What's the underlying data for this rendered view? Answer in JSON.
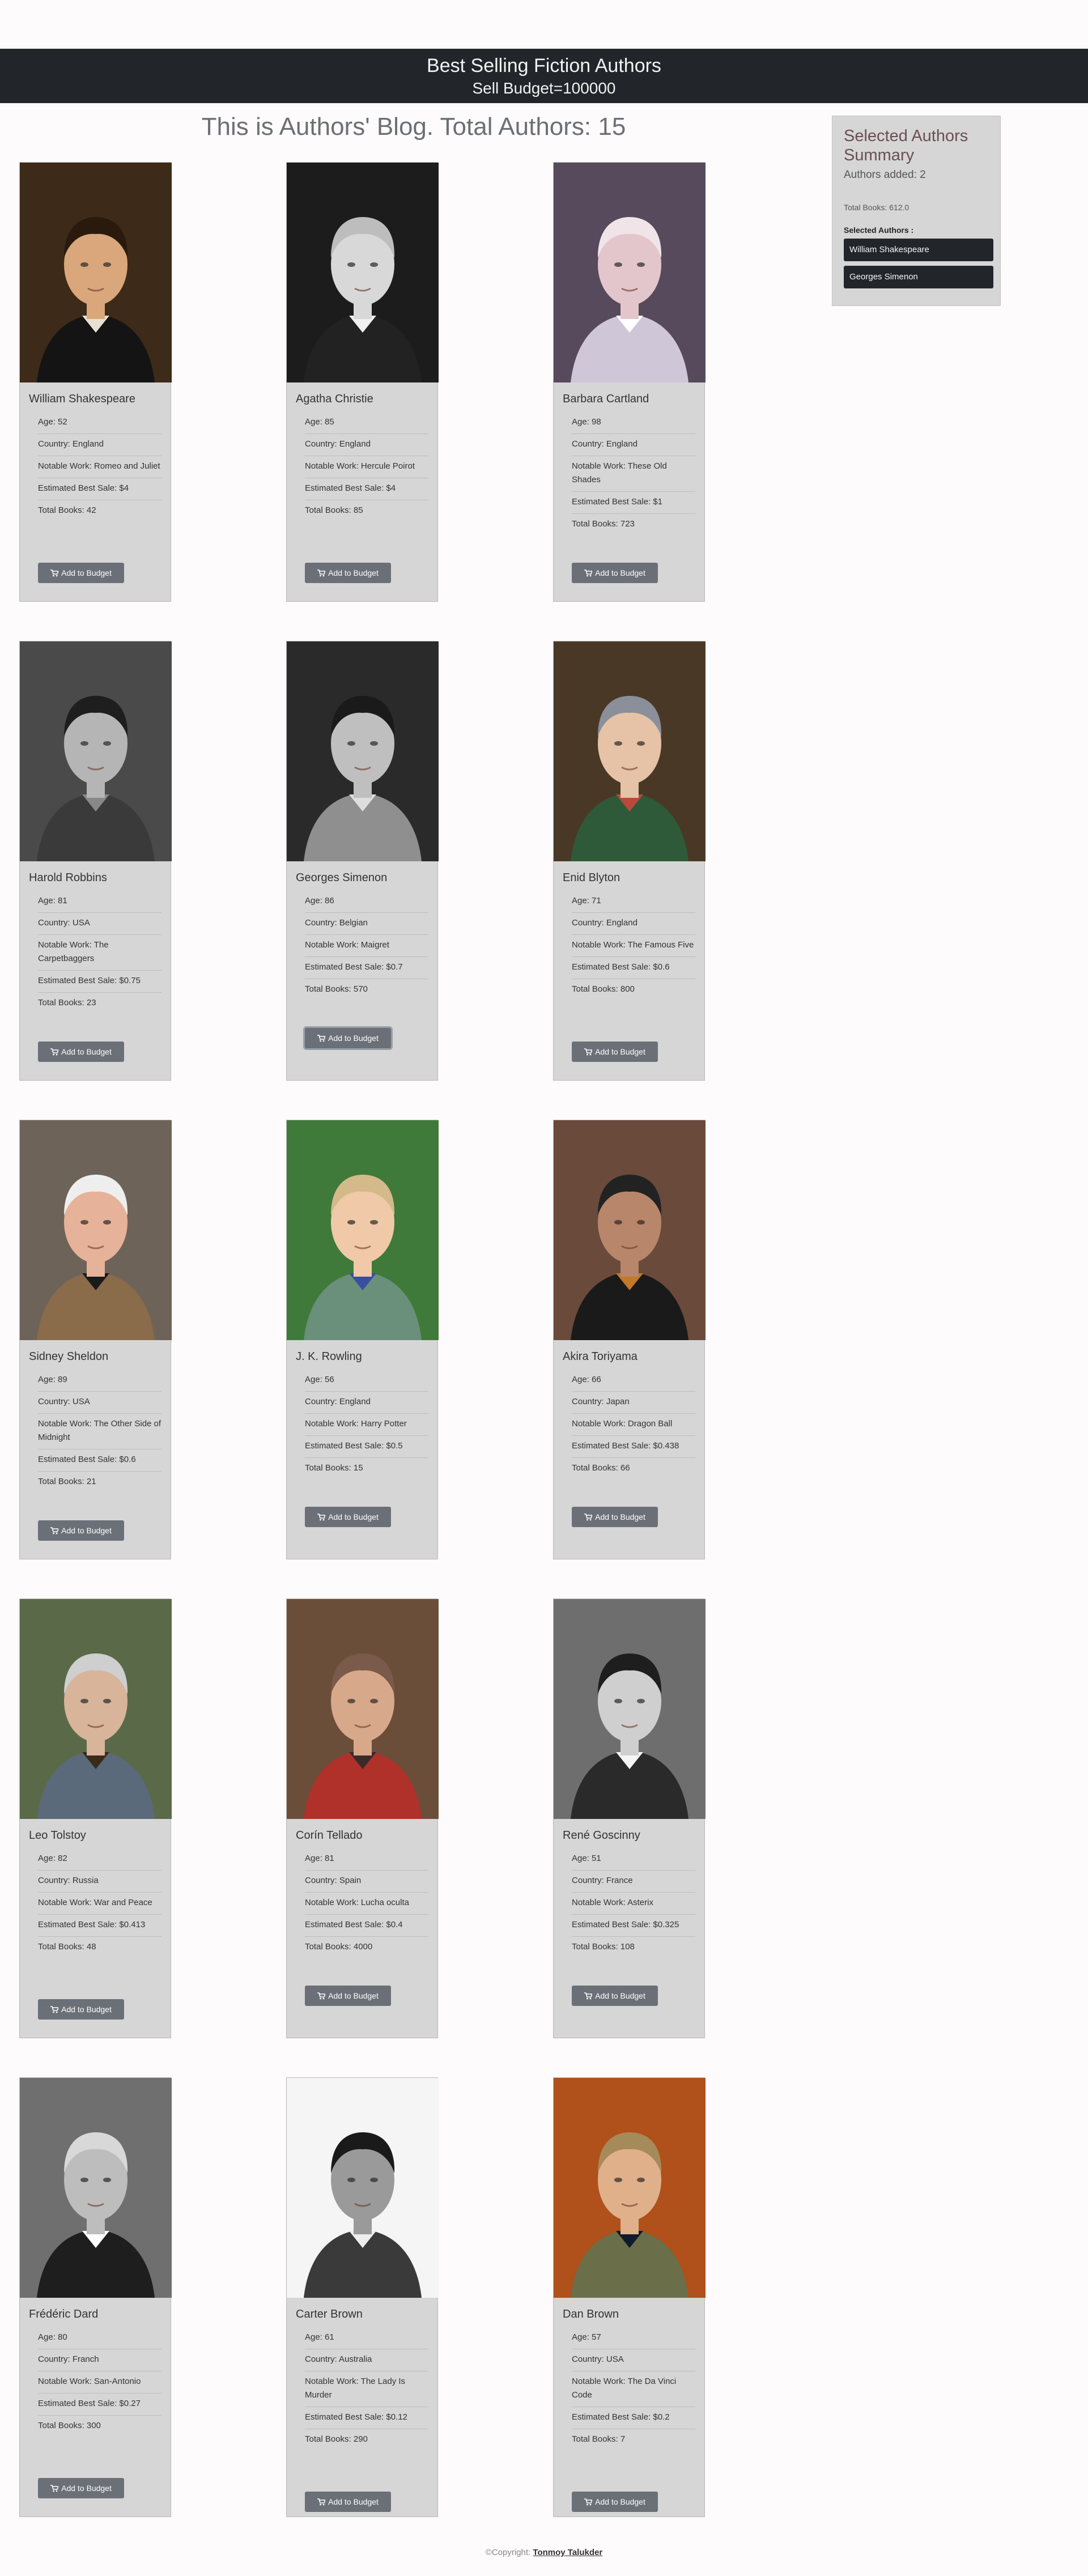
{
  "navbar": {
    "title": "Best Selling Fiction Authors",
    "budget": "Sell Budget=100000"
  },
  "main": {
    "heading": "This is Authors' Blog. Total Authors: 15"
  },
  "labels": {
    "add_button": "Add to Budget"
  },
  "authors": [
    {
      "name": "William Shakespeare",
      "age": "Age: 52",
      "country": "Country: England",
      "work": "Notable Work: Romeo and Juliet",
      "sale": "Estimated Best Sale: $4",
      "books": "Total Books: 42"
    },
    {
      "name": "Agatha Christie",
      "age": "Age: 85",
      "country": "Country: England",
      "work": "Notable Work: Hercule Poirot",
      "sale": "Estimated Best Sale: $4",
      "books": "Total Books: 85"
    },
    {
      "name": "Barbara Cartland",
      "age": "Age: 98",
      "country": "Country: England",
      "work": "Notable Work: These Old Shades",
      "sale": "Estimated Best Sale: $1",
      "books": "Total Books: 723"
    },
    {
      "name": "Harold Robbins",
      "age": "Age: 81",
      "country": "Country: USA",
      "work": "Notable Work: The Carpetbaggers",
      "sale": "Estimated Best Sale: $0.75",
      "books": "Total Books: 23"
    },
    {
      "name": "Georges Simenon",
      "age": "Age: 86",
      "country": "Country: Belgian",
      "work": "Notable Work: Maigret",
      "sale": "Estimated Best Sale: $0.7",
      "books": "Total Books: 570"
    },
    {
      "name": "Enid Blyton",
      "age": "Age: 71",
      "country": "Country: England",
      "work": "Notable Work: The Famous Five",
      "sale": "Estimated Best Sale: $0.6",
      "books": "Total Books: 800"
    },
    {
      "name": "Sidney Sheldon",
      "age": "Age: 89",
      "country": "Country: USA",
      "work": "Notable Work: The Other Side of Midnight",
      "sale": "Estimated Best Sale: $0.6",
      "books": "Total Books: 21"
    },
    {
      "name": "J. K. Rowling",
      "age": "Age: 56",
      "country": "Country: England",
      "work": "Notable Work: Harry Potter",
      "sale": "Estimated Best Sale: $0.5",
      "books": "Total Books: 15"
    },
    {
      "name": "Akira Toriyama",
      "age": "Age: 66",
      "country": "Country: Japan",
      "work": "Notable Work: Dragon Ball",
      "sale": "Estimated Best Sale: $0.438",
      "books": "Total Books: 66"
    },
    {
      "name": "Leo Tolstoy",
      "age": "Age: 82",
      "country": "Country: Russia",
      "work": "Notable Work: War and Peace",
      "sale": "Estimated Best Sale: $0.413",
      "books": "Total Books: 48"
    },
    {
      "name": "Corín Tellado",
      "age": "Age: 81",
      "country": "Country: Spain",
      "work": "Notable Work: Lucha oculta",
      "sale": "Estimated Best Sale: $0.4",
      "books": "Total Books: 4000"
    },
    {
      "name": "René Goscinny",
      "age": "Age: 51",
      "country": "Country: France",
      "work": "Notable Work: Asterix",
      "sale": "Estimated Best Sale: $0.325",
      "books": "Total Books: 108"
    },
    {
      "name": "Frédéric Dard",
      "age": "Age: 80",
      "country": "Country: Franch",
      "work": "Notable Work: San-Antonio",
      "sale": "Estimated Best Sale: $0.27",
      "books": "Total Books: 300"
    },
    {
      "name": "Carter Brown",
      "age": "Age: 61",
      "country": "Country: Australia",
      "work": "Notable Work: The Lady Is Murder",
      "sale": "Estimated Best Sale: $0.12",
      "books": "Total Books: 290"
    },
    {
      "name": "Dan Brown",
      "age": "Age: 57",
      "country": "Country: USA",
      "work": "Notable Work: The Da Vinci Code",
      "sale": "Estimated Best Sale: $0.2",
      "books": "Total Books: 7"
    }
  ],
  "summary": {
    "title": "Selected Authors Summary",
    "added": "Authors added: 2",
    "total_books": "Total Books: 612.0",
    "selected_label": "Selected Authors :",
    "selected": [
      "William Shakespeare",
      "Georges Simenon"
    ]
  },
  "footer": {
    "copyright": "©Copyright: ",
    "owner": "Tonmoy Talukder"
  },
  "colors": {
    "navbar": "#22262b",
    "card": "#d6d6d6",
    "button": "#6b7078",
    "summary_title": "#6b4e55"
  }
}
